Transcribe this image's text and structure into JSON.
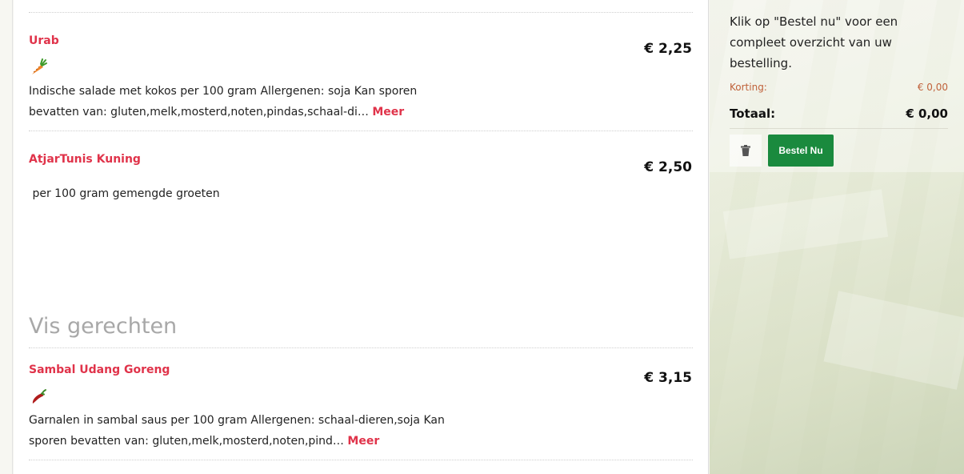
{
  "menu": {
    "items_top": [
      {
        "name": "Urab",
        "price": "€ 2,25",
        "icon": "carrot-icon",
        "description": "Indische salade met kokos per 100 gram   Allergenen: soja Kan sporen bevatten van: gluten,melk,mosterd,noten,pindas,schaal-di…",
        "more_label": "Meer"
      },
      {
        "name": "AtjarTunis Kuning",
        "price": "€ 2,50",
        "description": " per 100 gram gemengde groeten"
      }
    ],
    "section_title": "Vis gerechten",
    "items_vis": [
      {
        "name": "Sambal Udang Goreng",
        "price": "€ 3,15",
        "icon": "chili-pepper-icon",
        "description": "Garnalen in sambal saus per 100 gram   Allergenen: schaal-dieren,soja Kan sporen bevatten van: gluten,melk,mosterd,noten,pind…",
        "more_label": "Meer"
      }
    ]
  },
  "cart": {
    "message": "Klik op \"Bestel nu\" voor een compleet overzicht van uw bestelling.",
    "korting_label": "Korting:",
    "korting_value": "€ 0,00",
    "totaal_label": "Totaal:",
    "totaal_value": "€ 0,00",
    "trash_icon": "trash-icon",
    "order_button": "Bestel Nu"
  },
  "colors": {
    "accent_red": "#e0334a",
    "order_green": "#1a8a3e",
    "korting_orange": "#c0613a"
  }
}
